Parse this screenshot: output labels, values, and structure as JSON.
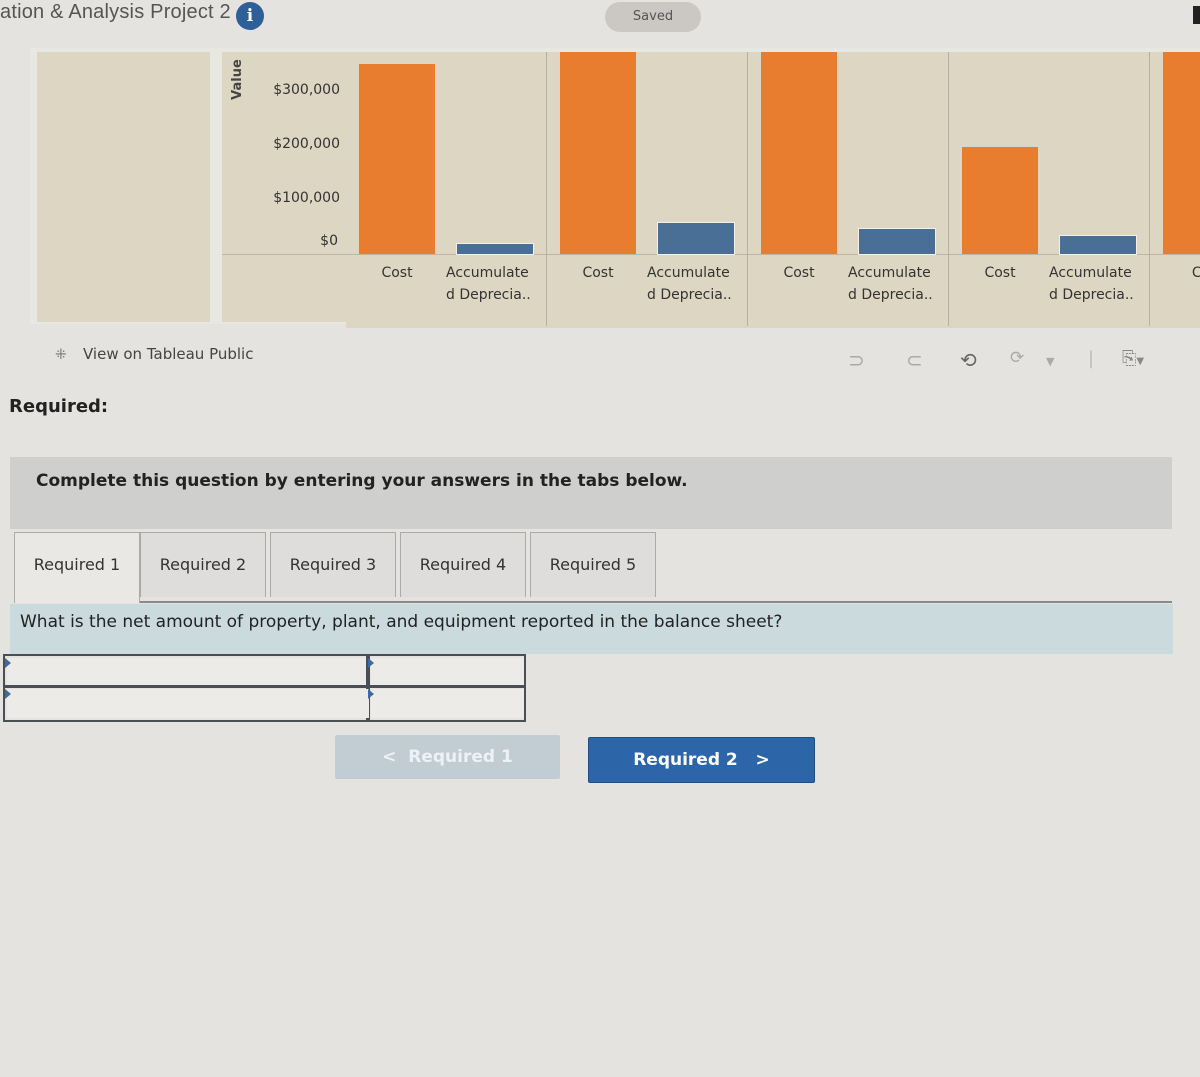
{
  "header": {
    "title": "ation & Analysis Project 2",
    "info_icon": "i",
    "saved_label": "Saved"
  },
  "colors": {
    "cost": "#e87c2f",
    "accumulated_depreciation": "#4a6f96",
    "primary_button": "#2d66a8"
  },
  "chart_data": {
    "type": "bar",
    "ylabel": "Value",
    "yticks": [
      "$300,000",
      "$200,000",
      "$100,000",
      "$0"
    ],
    "ylim": [
      0,
      380000
    ],
    "grid": false,
    "categories": [
      "Cost",
      "Accumulate\nd Deprecia.."
    ],
    "panels": [
      {
        "cost": 345000,
        "accumulated_depreciation": 18000
      },
      {
        "cost": 370000,
        "accumulated_depreciation": 56000
      },
      {
        "cost": 367000,
        "accumulated_depreciation": 45000
      },
      {
        "cost": 195000,
        "accumulated_depreciation": 33000
      },
      {
        "cost": 370000,
        "accumulated_depreciation": null
      }
    ],
    "x_labels": [
      [
        "Cost",
        "Accumulate",
        "d Deprecia.."
      ],
      [
        "Cost",
        "Accumulate",
        "d Deprecia.."
      ],
      [
        "Cost",
        "Accumulate",
        "d Deprecia.."
      ],
      [
        "Cost",
        "Accumulate",
        "d Deprecia.."
      ],
      [
        "Co"
      ]
    ]
  },
  "tableau": {
    "view_link": "View on Tableau Public",
    "toolbar": [
      "undo-icon",
      "redo-icon",
      "revert-icon",
      "refresh-icon",
      "dropdown-icon",
      "share-icon"
    ]
  },
  "required_heading": "Required:",
  "instructions": "Complete this question by entering your answers in the tabs below.",
  "tabs": [
    {
      "label": "Required 1",
      "active": true
    },
    {
      "label": "Required 2",
      "active": false
    },
    {
      "label": "Required 3",
      "active": false
    },
    {
      "label": "Required 4",
      "active": false
    },
    {
      "label": "Required 5",
      "active": false
    }
  ],
  "question": "What is the net amount of property, plant, and equipment reported in the balance sheet?",
  "answer_table": {
    "rows": [
      [
        "",
        ""
      ],
      [
        "",
        ""
      ]
    ]
  },
  "nav": {
    "prev_label": "Required 1",
    "prev_chevron": "<",
    "next_label": "Required 2",
    "next_chevron": ">"
  }
}
